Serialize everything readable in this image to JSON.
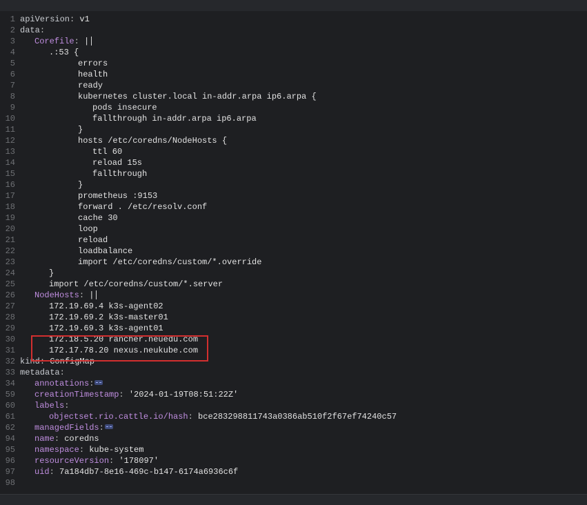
{
  "lines": [
    {
      "n": "1",
      "indent": 0,
      "key": "apiVersion",
      "sep": ": ",
      "val": "v1"
    },
    {
      "n": "2",
      "indent": 0,
      "key": "data",
      "sep": ":",
      "val": ""
    },
    {
      "n": "3",
      "indent": 1,
      "key": "Corefile",
      "sep": ": ",
      "val": "|",
      "cursor": true
    },
    {
      "n": "4",
      "indent": 2,
      "key": "",
      "sep": "",
      "val": ".:53 {"
    },
    {
      "n": "5",
      "indent": 4,
      "key": "",
      "sep": "",
      "val": "errors"
    },
    {
      "n": "6",
      "indent": 4,
      "key": "",
      "sep": "",
      "val": "health"
    },
    {
      "n": "7",
      "indent": 4,
      "key": "",
      "sep": "",
      "val": "ready"
    },
    {
      "n": "8",
      "indent": 4,
      "key": "",
      "sep": "",
      "val": "kubernetes cluster.local in-addr.arpa ip6.arpa {"
    },
    {
      "n": "9",
      "indent": 5,
      "key": "",
      "sep": "",
      "val": "pods insecure"
    },
    {
      "n": "10",
      "indent": 5,
      "key": "",
      "sep": "",
      "val": "fallthrough in-addr.arpa ip6.arpa"
    },
    {
      "n": "11",
      "indent": 4,
      "key": "",
      "sep": "",
      "val": "}"
    },
    {
      "n": "12",
      "indent": 4,
      "key": "",
      "sep": "",
      "val": "hosts /etc/coredns/NodeHosts {"
    },
    {
      "n": "13",
      "indent": 5,
      "key": "",
      "sep": "",
      "val": "ttl 60"
    },
    {
      "n": "14",
      "indent": 5,
      "key": "",
      "sep": "",
      "val": "reload 15s"
    },
    {
      "n": "15",
      "indent": 5,
      "key": "",
      "sep": "",
      "val": "fallthrough"
    },
    {
      "n": "16",
      "indent": 4,
      "key": "",
      "sep": "",
      "val": "}"
    },
    {
      "n": "17",
      "indent": 4,
      "key": "",
      "sep": "",
      "val": "prometheus :9153"
    },
    {
      "n": "18",
      "indent": 4,
      "key": "",
      "sep": "",
      "val": "forward . /etc/resolv.conf"
    },
    {
      "n": "19",
      "indent": 4,
      "key": "",
      "sep": "",
      "val": "cache 30"
    },
    {
      "n": "20",
      "indent": 4,
      "key": "",
      "sep": "",
      "val": "loop"
    },
    {
      "n": "21",
      "indent": 4,
      "key": "",
      "sep": "",
      "val": "reload"
    },
    {
      "n": "22",
      "indent": 4,
      "key": "",
      "sep": "",
      "val": "loadbalance"
    },
    {
      "n": "23",
      "indent": 4,
      "key": "",
      "sep": "",
      "val": "import /etc/coredns/custom/*.override"
    },
    {
      "n": "24",
      "indent": 2,
      "key": "",
      "sep": "",
      "val": "}"
    },
    {
      "n": "25",
      "indent": 2,
      "key": "",
      "sep": "",
      "val": "import /etc/coredns/custom/*.server"
    },
    {
      "n": "26",
      "indent": 1,
      "key": "NodeHosts",
      "sep": ": ",
      "val": "|",
      "cursor": true
    },
    {
      "n": "27",
      "indent": 2,
      "key": "",
      "sep": "",
      "val": "172.19.69.4 k3s-agent02"
    },
    {
      "n": "28",
      "indent": 2,
      "key": "",
      "sep": "",
      "val": "172.19.69.2 k3s-master01"
    },
    {
      "n": "29",
      "indent": 2,
      "key": "",
      "sep": "",
      "val": "172.19.69.3 k3s-agent01"
    },
    {
      "n": "30",
      "indent": 2,
      "key": "",
      "sep": "",
      "val": "172.18.5.20 rancher.neuedu.com"
    },
    {
      "n": "31",
      "indent": 2,
      "key": "",
      "sep": "",
      "val": "172.17.78.20 nexus.neukube.com"
    },
    {
      "n": "32",
      "indent": 0,
      "key": "kind",
      "sep": ": ",
      "val": "ConfigMap"
    },
    {
      "n": "33",
      "indent": 0,
      "key": "metadata",
      "sep": ":",
      "val": ""
    },
    {
      "n": "34",
      "indent": 1,
      "key": "annotations",
      "sep": ":",
      "val": "",
      "fold": true
    },
    {
      "n": "59",
      "indent": 1,
      "key": "creationTimestamp",
      "sep": ": ",
      "val": "'2024-01-19T08:51:22Z'"
    },
    {
      "n": "60",
      "indent": 1,
      "key": "labels",
      "sep": ":",
      "val": ""
    },
    {
      "n": "61",
      "indent": 2,
      "key": "objectset.rio.cattle.io/hash",
      "sep": ": ",
      "val": "bce283298811743a0386ab510f2f67ef74240c57"
    },
    {
      "n": "62",
      "indent": 1,
      "key": "managedFields",
      "sep": ":",
      "val": "",
      "fold": true
    },
    {
      "n": "94",
      "indent": 1,
      "key": "name",
      "sep": ": ",
      "val": "coredns"
    },
    {
      "n": "95",
      "indent": 1,
      "key": "namespace",
      "sep": ": ",
      "val": "kube-system"
    },
    {
      "n": "96",
      "indent": 1,
      "key": "resourceVersion",
      "sep": ": ",
      "val": "'178097'"
    },
    {
      "n": "97",
      "indent": 1,
      "key": "uid",
      "sep": ": ",
      "val": "7a184db7-8e16-469c-b147-6174a6936c6f"
    },
    {
      "n": "98",
      "indent": 0,
      "key": "",
      "sep": "",
      "val": ""
    }
  ],
  "colors": {
    "key": "#c9ccd1",
    "subkey": "#c08ee0",
    "value": "#e2e2e2",
    "highlight": "#d32f2f"
  }
}
